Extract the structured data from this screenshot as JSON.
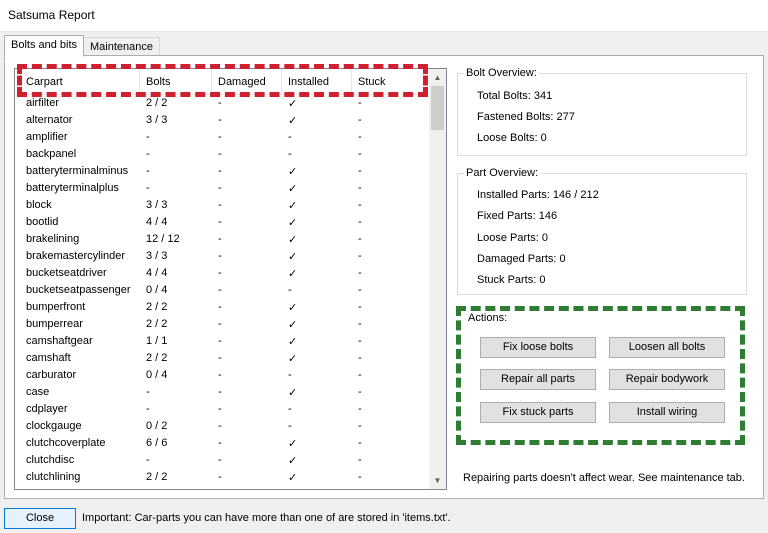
{
  "window": {
    "title": "Satsuma Report"
  },
  "tabs": [
    {
      "label": "Bolts and bits"
    },
    {
      "label": "Maintenance"
    }
  ],
  "table": {
    "headers": [
      "Carpart",
      "Bolts",
      "Damaged",
      "Installed",
      "Stuck"
    ],
    "rows": [
      [
        "airfilter",
        "2 / 2",
        "-",
        "✓",
        "-"
      ],
      [
        "alternator",
        "3 / 3",
        "-",
        "✓",
        "-"
      ],
      [
        "amplifier",
        "-",
        "-",
        "-",
        "-"
      ],
      [
        "backpanel",
        "-",
        "-",
        "-",
        "-"
      ],
      [
        "batteryterminalminus",
        "-",
        "-",
        "✓",
        "-"
      ],
      [
        "batteryterminalplus",
        "-",
        "-",
        "✓",
        "-"
      ],
      [
        "block",
        "3 / 3",
        "-",
        "✓",
        "-"
      ],
      [
        "bootlid",
        "4 / 4",
        "-",
        "✓",
        "-"
      ],
      [
        "brakelining",
        "12 / 12",
        "-",
        "✓",
        "-"
      ],
      [
        "brakemastercylinder",
        "3 / 3",
        "-",
        "✓",
        "-"
      ],
      [
        "bucketseatdriver",
        "4 / 4",
        "-",
        "✓",
        "-"
      ],
      [
        "bucketseatpassenger",
        "0 / 4",
        "-",
        "-",
        "-"
      ],
      [
        "bumperfront",
        "2 / 2",
        "-",
        "✓",
        "-"
      ],
      [
        "bumperrear",
        "2 / 2",
        "-",
        "✓",
        "-"
      ],
      [
        "camshaftgear",
        "1 / 1",
        "-",
        "✓",
        "-"
      ],
      [
        "camshaft",
        "2 / 2",
        "-",
        "✓",
        "-"
      ],
      [
        "carburator",
        "0 / 4",
        "-",
        "-",
        "-"
      ],
      [
        "case",
        "-",
        "-",
        "✓",
        "-"
      ],
      [
        "cdplayer",
        "-",
        "-",
        "-",
        "-"
      ],
      [
        "clockgauge",
        "0 / 2",
        "-",
        "-",
        "-"
      ],
      [
        "clutchcoverplate",
        "6 / 6",
        "-",
        "✓",
        "-"
      ],
      [
        "clutchdisc",
        "-",
        "-",
        "✓",
        "-"
      ],
      [
        "clutchlining",
        "2 / 2",
        "-",
        "✓",
        "-"
      ]
    ]
  },
  "bolt_overview": {
    "title": "Bolt Overview:",
    "total": "Total Bolts: 341",
    "fastened": "Fastened Bolts: 277",
    "loose": "Loose Bolts: 0"
  },
  "part_overview": {
    "title": "Part Overview:",
    "installed": "Installed Parts: 146 / 212",
    "fixed": "Fixed Parts: 146",
    "loose": "Loose Parts: 0",
    "damaged": "Damaged Parts: 0",
    "stuck": "Stuck Parts: 0"
  },
  "actions": {
    "title": "Actions:",
    "fix_loose_bolts": "Fix loose bolts",
    "loosen_all_bolts": "Loosen all bolts",
    "repair_all_parts": "Repair all parts",
    "repair_bodywork": "Repair bodywork",
    "fix_stuck_parts": "Fix stuck parts",
    "install_wiring": "Install wiring"
  },
  "note": "Repairing parts doesn't affect wear. See maintenance tab.",
  "footer": {
    "close_label": "Close",
    "status": "Important: Car-parts you can have more than one of are stored in 'items.txt'."
  },
  "colors": {
    "highlight_red": "#d02030",
    "highlight_green": "#2e7d32",
    "focus_blue": "#0078d7"
  }
}
